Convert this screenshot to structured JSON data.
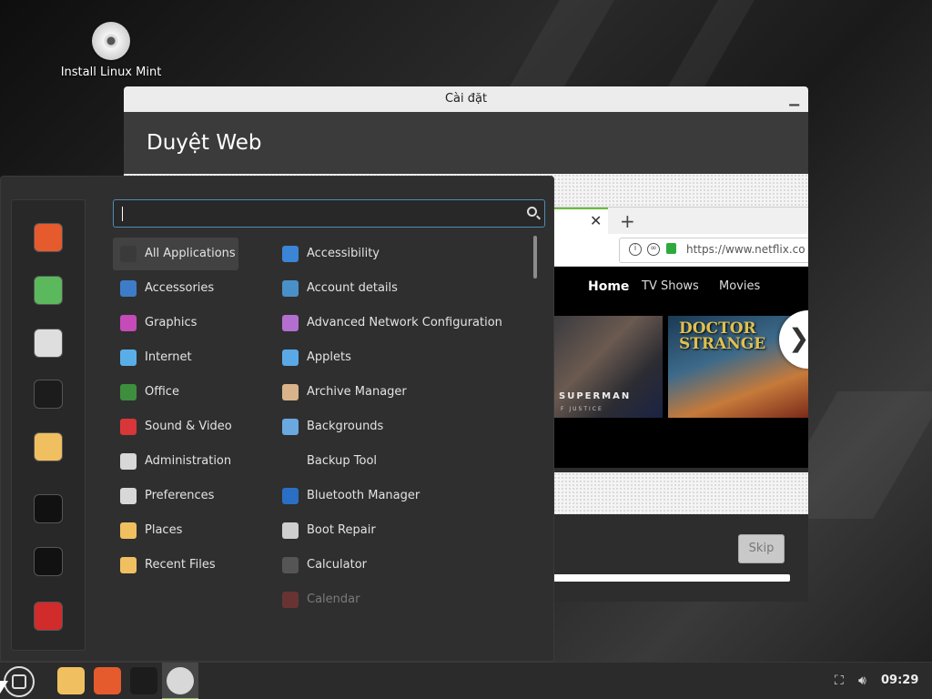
{
  "desktop": {
    "icons": [
      {
        "label": "Install Linux Mint",
        "icon": "disc-icon"
      }
    ]
  },
  "installer": {
    "title": "Cài đặt",
    "header": "Duyệt Web",
    "browser": {
      "url": "https://www.netflix.co",
      "nav": [
        "Home",
        "TV Shows",
        "Movies"
      ],
      "posters": [
        {
          "title": "SUPERMAN",
          "subtitle": "F JUSTICE"
        },
        {
          "title_line1": "DOCTOR",
          "title_line2": "STRANGE"
        }
      ]
    },
    "skip_label": "Skip",
    "progress": 1.0
  },
  "menu": {
    "search": {
      "value": "",
      "placeholder": ""
    },
    "favorites": [
      {
        "name": "firefox-icon",
        "color": "#e55b2d"
      },
      {
        "name": "software-manager-icon",
        "color": "#5cb85c"
      },
      {
        "name": "settings-icon",
        "color": "#dedede"
      },
      {
        "name": "terminal-icon",
        "color": "#1c1c1c"
      },
      {
        "name": "files-icon",
        "color": "#f0c060"
      },
      {
        "name": "lock-screen-icon",
        "color": "#111111"
      },
      {
        "name": "logout-icon",
        "color": "#111111"
      },
      {
        "name": "power-icon",
        "color": "#d12b2b"
      }
    ],
    "categories": [
      {
        "label": "All Applications",
        "icon": "grid-icon",
        "color": "#3a3a3a"
      },
      {
        "label": "Accessories",
        "icon": "scissors-icon",
        "color": "#3d7cc9"
      },
      {
        "label": "Graphics",
        "icon": "graphics-icon",
        "color": "#c44bb8"
      },
      {
        "label": "Internet",
        "icon": "cloud-icon",
        "color": "#5aaee8"
      },
      {
        "label": "Office",
        "icon": "office-icon",
        "color": "#3e8e3e"
      },
      {
        "label": "Sound & Video",
        "icon": "play-icon",
        "color": "#d9363a"
      },
      {
        "label": "Administration",
        "icon": "admin-icon",
        "color": "#d8d8d8"
      },
      {
        "label": "Preferences",
        "icon": "preferences-icon",
        "color": "#d8d8d8"
      },
      {
        "label": "Places",
        "icon": "folder-icon",
        "color": "#f0c060"
      },
      {
        "label": "Recent Files",
        "icon": "recent-folder-icon",
        "color": "#f0c060"
      }
    ],
    "apps": [
      {
        "label": "Accessibility",
        "icon": "accessibility-icon",
        "color": "#3b84d6",
        "dim": false
      },
      {
        "label": "Account details",
        "icon": "account-icon",
        "color": "#4a90c8",
        "dim": false
      },
      {
        "label": "Advanced Network Configuration",
        "icon": "network-config-icon",
        "color": "#b36fcf",
        "dim": false
      },
      {
        "label": "Applets",
        "icon": "applets-icon",
        "color": "#5aa9e6",
        "dim": false
      },
      {
        "label": "Archive Manager",
        "icon": "archive-icon",
        "color": "#d9b48a",
        "dim": false
      },
      {
        "label": "Backgrounds",
        "icon": "backgrounds-icon",
        "color": "#6aa8e0",
        "dim": false
      },
      {
        "label": "Backup Tool",
        "icon": "backup-icon",
        "color": "#2f2f2f",
        "dim": false
      },
      {
        "label": "Bluetooth Manager",
        "icon": "bluetooth-icon",
        "color": "#2a6fc4",
        "dim": false
      },
      {
        "label": "Boot Repair",
        "icon": "boot-repair-icon",
        "color": "#cfcfcf",
        "dim": false
      },
      {
        "label": "Calculator",
        "icon": "calculator-icon",
        "color": "#555555",
        "dim": false
      },
      {
        "label": "Calendar",
        "icon": "calendar-icon",
        "color": "#b23a3a",
        "dim": true
      }
    ]
  },
  "taskbar": {
    "clock": "09:29",
    "launchers": [
      {
        "name": "files-icon",
        "color": "#f0c060"
      },
      {
        "name": "firefox-icon",
        "color": "#e55b2d"
      },
      {
        "name": "terminal-icon",
        "color": "#1c1c1c"
      },
      {
        "name": "installer-disc-icon",
        "color": "#d8d8d8"
      }
    ],
    "accent": "#8cc04b"
  }
}
